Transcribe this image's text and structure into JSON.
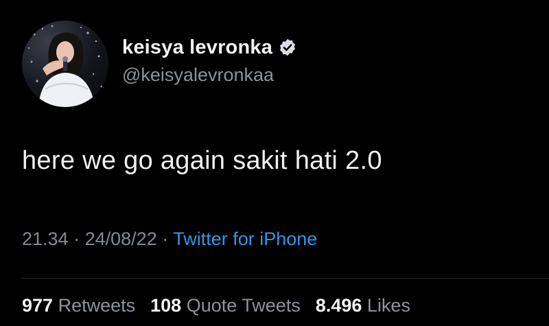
{
  "user": {
    "display_name": "keisya levronka",
    "handle": "@keisyalevronkaa",
    "verified": true,
    "avatar_icon": "profile-photo",
    "verified_icon": "verified-badge-icon"
  },
  "tweet": {
    "text": "here we go again sakit hati 2.0",
    "time": "21.34",
    "separator": "·",
    "date": "24/08/22",
    "source": "Twitter for iPhone"
  },
  "stats": {
    "retweets": {
      "count": "977",
      "label": "Retweets"
    },
    "quotes": {
      "count": "108",
      "label": "Quote Tweets"
    },
    "likes": {
      "count": "8.496",
      "label": "Likes"
    }
  },
  "colors": {
    "background": "#000000",
    "text": "#e7e9ea",
    "muted": "#8b939b",
    "link": "#2e97e6"
  }
}
